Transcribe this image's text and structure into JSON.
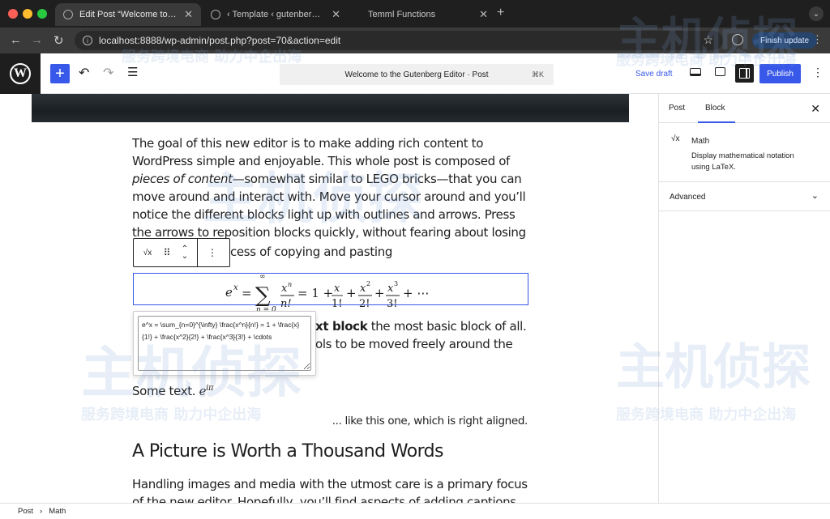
{
  "browser": {
    "tabs": [
      {
        "title": "Edit Post “Welcome to the G",
        "active": true
      },
      {
        "title": "‹ Template ‹ gutenberg ‹ Edit",
        "active": false
      },
      {
        "title": "Temml Functions",
        "active": false
      }
    ],
    "url": "localhost:8888/wp-admin/post.php?post=70&action=edit",
    "finish_update": "Finish update"
  },
  "header": {
    "document_title": "Welcome to the Gutenberg Editor · Post",
    "shortcut": "⌘K",
    "save_draft": "Save draft",
    "publish": "Publish"
  },
  "content": {
    "para1_a": "The goal of this new editor is to make adding rich content to WordPress simple and enjoyable. This whole post is composed of ",
    "para1_em": "pieces of content",
    "para1_b": "—somewhat similar to LEGO bricks—that you can move around and interact with. Move your cursor around and you’ll notice the different blocks light up with outlines and arrows. Press the arrows to reposition blocks quickly, without fearing about losing",
    "para1_tail": "cess of copying and pasting",
    "latex": "e^x = \\sum_{n=0}^{\\infty} \\frac{x^n}{n!} = 1 + \\frac{x}{1!} + \\frac{x^2}{2!} + \\frac{x^3}{3!} + \\cdots",
    "para2_bold": "xt block",
    "para2_rest": " the most basic block of all.",
    "para2_line2": "ols to be moved freely around the",
    "some_text": "Some text. ",
    "some_text_exp": "iπ",
    "right_aligned": "... like this one, which is right aligned.",
    "heading": "A Picture is Worth a Thousand Words",
    "para3": "Handling images and media with the utmost care is a primary focus of the new editor. Hopefully, you’ll find aspects of adding captions or"
  },
  "sidebar": {
    "tab_post": "Post",
    "tab_block": "Block",
    "block_name": "Math",
    "block_desc": "Display mathematical notation using LaTeX.",
    "advanced": "Advanced"
  },
  "footer": {
    "crumb_1": "Post",
    "crumb_2": "Math"
  },
  "watermark": {
    "brand": "主机侦探",
    "tagline": "服务跨境电商 助力中企出海"
  },
  "colors": {
    "accent": "#3858e9",
    "chrome": "#3a3a3a"
  }
}
